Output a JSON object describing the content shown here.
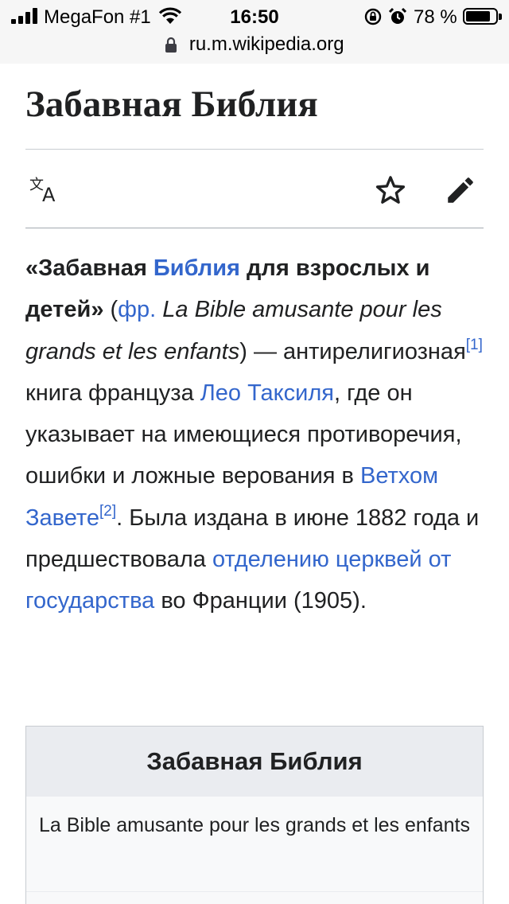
{
  "status_bar": {
    "carrier": "MegaFon #1",
    "time": "16:50",
    "battery_percent": "78 %",
    "battery_level": 0.78
  },
  "browser": {
    "url": "ru.m.wikipedia.org"
  },
  "article": {
    "title": "Забавная Библия",
    "actions": {
      "language_icon": "translate-icon",
      "watch_icon": "star-icon",
      "edit_icon": "pencil-icon"
    },
    "lead": {
      "p1": "«Забавная ",
      "link_bible": "Библия",
      "p2": " для взрослых и детей»",
      "p3": " (",
      "link_fr": "фр.",
      "p4_italic": " La Bible amusante pour les grands et les enfants",
      "p5": ") — антирелигиозная",
      "ref1": "[1]",
      "p6": " книга француза ",
      "link_leo": "Лео Таксиля",
      "p7": ", где он указывает на имеющиеся противоречия, ошибки и ложные верования в ",
      "link_ot": "Ветхом Завете",
      "ref2": "[2]",
      "p8": ". Была издана в июне 1882 года и предшествовала ",
      "link_sep": "отделению церквей от государства",
      "p9": " во Франции (1905)."
    },
    "infobox": {
      "heading": "Забавная Библия",
      "original_title": "La Bible amusante pour les grands et les enfants"
    }
  },
  "colors": {
    "link": "#3366cc",
    "text": "#202122",
    "topbar_bg": "#f6f6f6",
    "infobox_head_bg": "#eaecf0"
  }
}
